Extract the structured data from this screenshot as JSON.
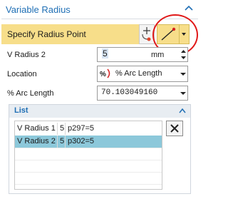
{
  "panel": {
    "title": "Variable Radius",
    "collapse_icon": "chevron-up-icon"
  },
  "specify": {
    "label": "Specify Radius Point",
    "add_icon": "add-point-icon",
    "tool_icon": "line-point-icon",
    "dropdown_icon": "caret-down-icon"
  },
  "fields": {
    "v_radius_2": {
      "label": "V Radius 2",
      "value": "5",
      "unit": "mm"
    },
    "location": {
      "label": "Location",
      "value": "% Arc Length",
      "icon": "percent-arc-icon"
    },
    "arc_length": {
      "label": "% Arc Length",
      "value": "70.103049160"
    }
  },
  "list": {
    "title": "List",
    "rows": [
      {
        "name": "V Radius 1",
        "value": "5",
        "expr": "p297=5",
        "selected": false
      },
      {
        "name": "V Radius 2",
        "value": "5",
        "expr": "p302=5",
        "selected": true
      }
    ],
    "delete_icon": "delete-x-icon"
  },
  "colors": {
    "accent": "#1f6fb5",
    "highlight": "#f7de8a",
    "selection": "#8cc8da",
    "annotation": "#e01818"
  }
}
